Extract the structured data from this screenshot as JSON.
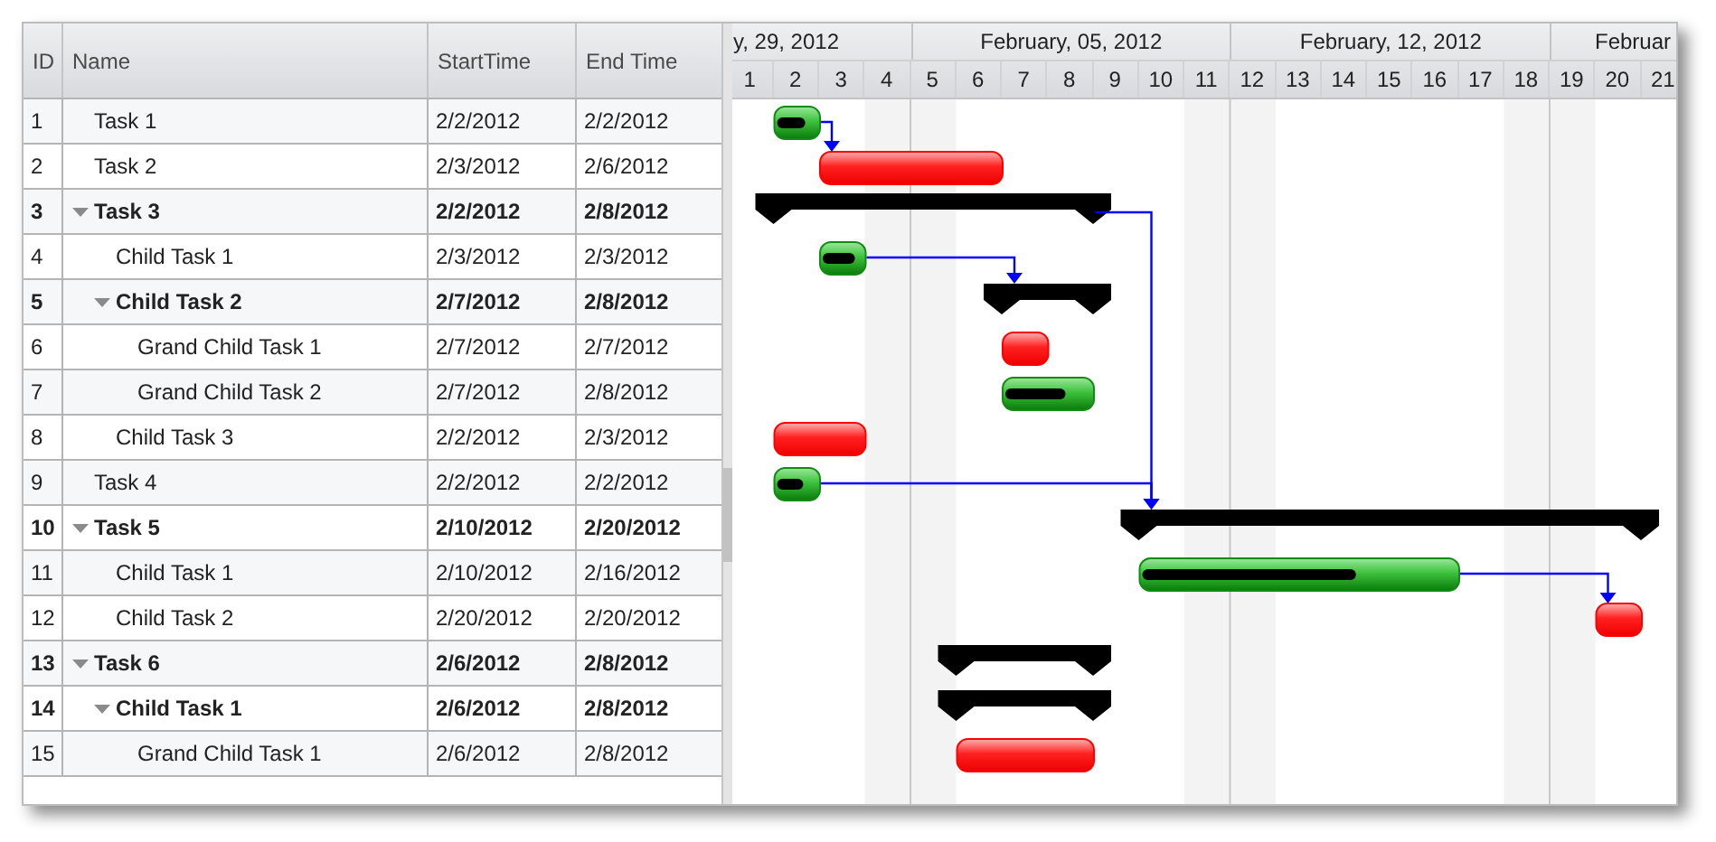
{
  "grid": {
    "columns": [
      "ID",
      "Name",
      "StartTime",
      "End Time"
    ],
    "rows": [
      {
        "id": "1",
        "name": "Task 1",
        "start": "2/2/2012",
        "end": "2/2/2012",
        "kind": "started",
        "level": 0.7,
        "arrow_out": true
      },
      {
        "id": "2",
        "name": "Task 2",
        "start": "2/3/2012",
        "end": "2/6/2012",
        "kind": "pending",
        "arrow_out": false
      },
      {
        "id": "3",
        "name": "Task 3",
        "start": "2/2/2012",
        "end": "2/8/2012",
        "kind": "summary",
        "expanded": true,
        "arrow_out": true,
        "children": [
          {
            "id": "4",
            "name": "Child Task 1",
            "start": "2/3/2012",
            "end": "2/3/2012",
            "kind": "started",
            "level": 0.8,
            "arrow_out": true
          },
          {
            "id": "5",
            "name": "Child Task 2",
            "start": "2/7/2012",
            "end": "2/8/2012",
            "kind": "summary",
            "expanded": true,
            "arrow_out": false,
            "children": [
              {
                "id": "6",
                "name": "Grand Child Task 1",
                "start": "2/7/2012",
                "end": "2/7/2012",
                "kind": "pending",
                "arrow_out": false
              },
              {
                "id": "7",
                "name": "Grand Child Task 2",
                "start": "2/7/2012",
                "end": "2/8/2012",
                "kind": "started",
                "level": 0.7,
                "arrow_out": false
              }
            ]
          },
          {
            "id": "8",
            "name": "Child Task 3",
            "start": "2/2/2012",
            "end": "2/3/2012",
            "kind": "pending",
            "arrow_out": false
          }
        ]
      },
      {
        "id": "9",
        "name": "Task 4",
        "start": "2/2/2012",
        "end": "2/2/2012",
        "kind": "started",
        "level": 0.65,
        "arrow_out": true
      },
      {
        "id": "10",
        "name": "Task 5",
        "start": "2/10/2012",
        "end": "2/20/2012",
        "kind": "summary",
        "expanded": true,
        "arrow_out": false,
        "children": [
          {
            "id": "11",
            "name": "Child Task 1",
            "start": "2/10/2012",
            "end": "2/16/2012",
            "kind": "started",
            "level": 0.68,
            "arrow_out": true
          },
          {
            "id": "12",
            "name": "Child Task 2",
            "start": "2/20/2012",
            "end": "2/20/2012",
            "kind": "pending",
            "arrow_out": false
          }
        ]
      },
      {
        "id": "13",
        "name": "Task 6",
        "start": "2/6/2012",
        "end": "2/8/2012",
        "kind": "summary",
        "expanded": true,
        "arrow_out": false,
        "children": [
          {
            "id": "14",
            "name": "Child Task 1",
            "start": "2/6/2012",
            "end": "2/8/2012",
            "kind": "summary",
            "expanded": true,
            "arrow_out": false,
            "children": [
              {
                "id": "15",
                "name": "Grand Child Task 1",
                "start": "2/6/2012",
                "end": "2/8/2012",
                "kind": "pending",
                "arrow_out": false
              }
            ]
          }
        ]
      }
    ]
  },
  "timeline": {
    "weeks": [
      {
        "label": "y, 29, 2012",
        "days": [
          {
            "label": "1",
            "weekend": false
          },
          {
            "label": "2",
            "weekend": false
          },
          {
            "label": "3",
            "weekend": false
          },
          {
            "label": "4",
            "weekend": true
          }
        ]
      },
      {
        "label": "February, 05, 2012",
        "days": [
          {
            "label": "5",
            "weekend": true
          },
          {
            "label": "6",
            "weekend": false
          },
          {
            "label": "7",
            "weekend": false
          },
          {
            "label": "8",
            "weekend": false
          },
          {
            "label": "9",
            "weekend": false
          },
          {
            "label": "10",
            "weekend": false
          },
          {
            "label": "11",
            "weekend": true
          }
        ]
      },
      {
        "label": "February, 12, 2012",
        "days": [
          {
            "label": "12",
            "weekend": true
          },
          {
            "label": "13",
            "weekend": false
          },
          {
            "label": "14",
            "weekend": false
          },
          {
            "label": "15",
            "weekend": false
          },
          {
            "label": "16",
            "weekend": false
          },
          {
            "label": "17",
            "weekend": false
          },
          {
            "label": "18",
            "weekend": true
          }
        ]
      },
      {
        "label": "Februar",
        "days": [
          {
            "label": "19",
            "weekend": true
          },
          {
            "label": "20",
            "weekend": false
          },
          {
            "label": "21",
            "weekend": false
          }
        ]
      }
    ]
  }
}
